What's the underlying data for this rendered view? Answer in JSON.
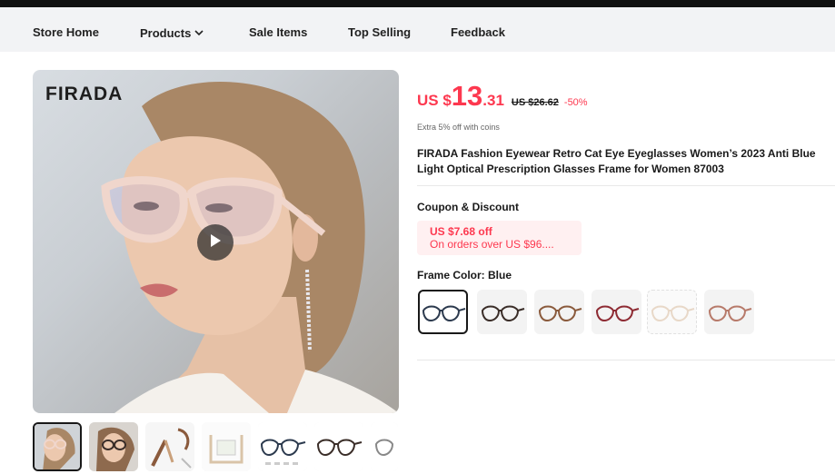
{
  "nav": {
    "items": [
      {
        "label": "Store Home"
      },
      {
        "label": "Products",
        "has_dropdown": true
      },
      {
        "label": "Sale Items"
      },
      {
        "label": "Top Selling"
      },
      {
        "label": "Feedback"
      }
    ]
  },
  "gallery": {
    "brand_logo": "FIRADA",
    "main_image_icon": "play-icon",
    "thumbnail_count": 7,
    "active_thumbnail": 1
  },
  "product": {
    "price_currency": "US $",
    "price_integer": "13",
    "price_decimal": ".31",
    "original_price": "US $26.62",
    "discount": "-50%",
    "coins_note": "Extra 5% off with coins",
    "title": "FIRADA Fashion Eyewear Retro Cat Eye Eyeglasses Women’s 2023 Anti Blue Light Optical Prescription Glasses Frame for Women 87003"
  },
  "coupon": {
    "heading": "Coupon & Discount",
    "amount": "US $7.68 off",
    "condition": "On orders over US $96...."
  },
  "frame_color": {
    "heading": "Frame Color: Blue",
    "swatches": [
      {
        "frame_color": "#2c3a4e",
        "selected": true
      },
      {
        "frame_color": "#3a2d28",
        "selected": false
      },
      {
        "frame_color": "#8a5a3c",
        "selected": false
      },
      {
        "frame_color": "#8e2b33",
        "selected": false
      },
      {
        "frame_color": "#e8d8c8",
        "selected": false
      },
      {
        "frame_color": "#b77a6a",
        "selected": false
      }
    ]
  },
  "colors": {
    "accent": "#fd384f",
    "nav_bg": "#f2f3f5",
    "coupon_bg": "#fff0f1"
  }
}
